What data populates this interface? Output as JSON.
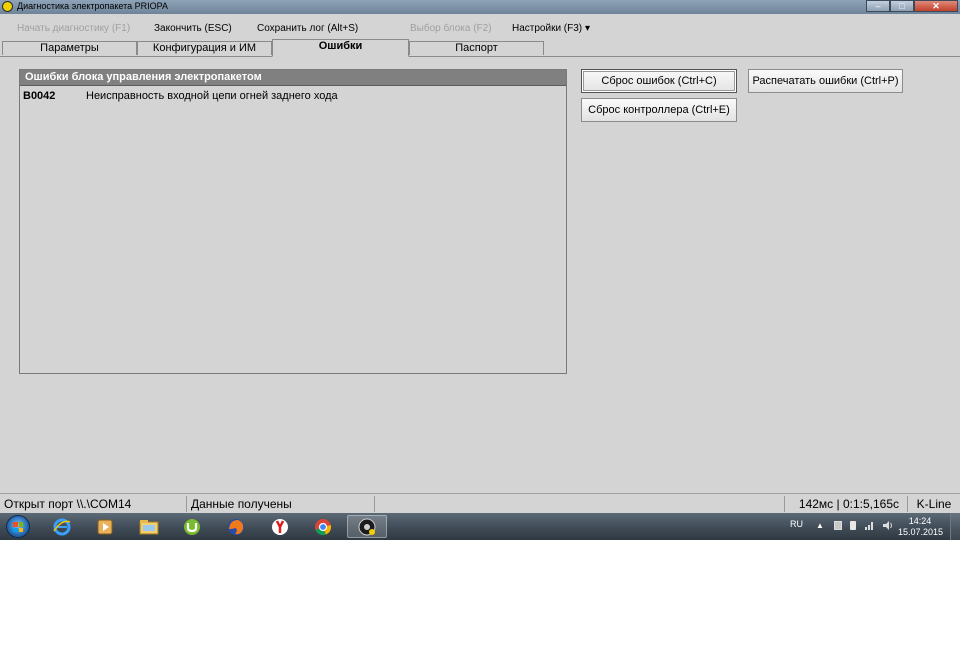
{
  "window": {
    "title": "Диагностика электропакета PRIOРА",
    "buttons": {
      "minimize": "–",
      "maximize": "□",
      "close": "✕"
    }
  },
  "menu": {
    "start_diag": "Начать диагностику (F1)",
    "finish": "Закончить (ESC)",
    "save_log": "Сохранить лог (Alt+S)",
    "select_block": "Выбор блока (F2)",
    "settings": "Настройки (F3)",
    "settings_arrow": "▾"
  },
  "tabs": [
    {
      "label": "Параметры",
      "active": false
    },
    {
      "label": "Конфигурация и ИМ",
      "active": false
    },
    {
      "label": "Ошибки",
      "active": true
    },
    {
      "label": "Паспорт",
      "active": false
    }
  ],
  "error_panel": {
    "header": "Ошибки блока управления электропакетом",
    "rows": [
      {
        "code": "B0042",
        "description": "Неисправность входной цепи огней заднего хода"
      }
    ]
  },
  "actions": {
    "reset_errors": "Сброс ошибок (Ctrl+C)",
    "print_errors": "Распечатать ошибки (Ctrl+P)",
    "reset_controller": "Сброс контроллера (Ctrl+E)"
  },
  "statusbar": {
    "port": "Открыт порт \\\\.\\COM14",
    "status": "Данные получены",
    "empty": "",
    "timing": "142мс | 0:1:5,165с",
    "protocol": "K-Line"
  },
  "taskbar": {
    "apps": [
      "ie-icon",
      "media-player-icon",
      "file-explorer-icon",
      "utorrent-icon",
      "firefox-icon",
      "yandex-browser-icon",
      "chrome-icon",
      "diagnostic-app-icon"
    ],
    "language": "RU",
    "time": "14:24",
    "date": "15.07.2015"
  }
}
